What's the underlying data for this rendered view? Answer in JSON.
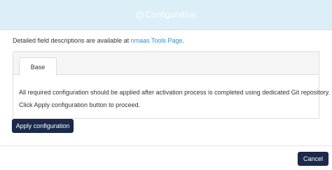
{
  "modal": {
    "title": "Configuration",
    "info_icon": "info-circle-icon"
  },
  "description": {
    "text": "Detailed field descriptions are available at ",
    "link_text": "nmaas Tools Page",
    "suffix": "."
  },
  "tabs": [
    {
      "label": "Base",
      "active": true
    }
  ],
  "tab_content": {
    "line1": "All required configuration should be applied after activation process is completed using dedicated Git repository.",
    "line2": "Click Apply configuration button to proceed."
  },
  "buttons": {
    "apply_label": "Apply configuration",
    "cancel_label": "Cancel"
  },
  "colors": {
    "header_bg": "#dceef8",
    "button_bg": "#1b2a4c",
    "link": "#2f8fd0"
  }
}
